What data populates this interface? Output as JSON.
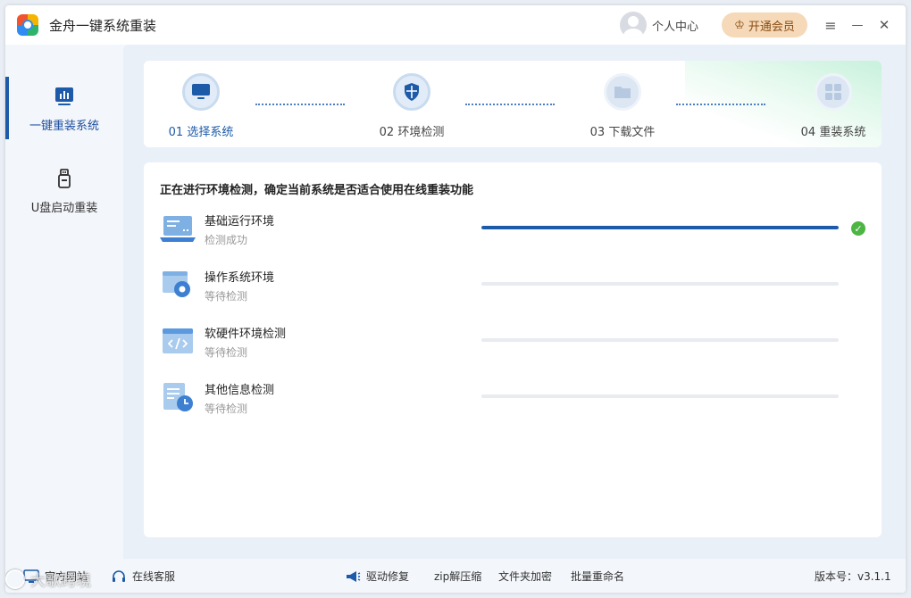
{
  "app": {
    "title": "金舟一键系统重装"
  },
  "titlebar": {
    "user_center": "个人中心",
    "vip_label": "开通会员",
    "menu_icon": "≡",
    "minimize_icon": "—",
    "close_icon": "✕"
  },
  "sidebar": {
    "items": [
      {
        "label": "一键重装系统",
        "active": true
      },
      {
        "label": "U盘启动重装",
        "active": false
      }
    ]
  },
  "steps": [
    {
      "label": "01 选择系统",
      "active": true
    },
    {
      "label": "02 环境检测",
      "active": false
    },
    {
      "label": "03 下载文件",
      "active": false
    },
    {
      "label": "04 重装系统",
      "active": false
    }
  ],
  "check": {
    "title": "正在进行环境检测，确定当前系统是否适合使用在线重装功能",
    "items": [
      {
        "name": "基础运行环境",
        "status": "检测成功",
        "progress": 1.0,
        "done": true
      },
      {
        "name": "操作系统环境",
        "status": "等待检测",
        "progress": 0,
        "done": false
      },
      {
        "name": "软硬件环境检测",
        "status": "等待检测",
        "progress": 0,
        "done": false
      },
      {
        "name": "其他信息检测",
        "status": "等待检测",
        "progress": 0,
        "done": false
      }
    ]
  },
  "footer": {
    "website": "官方网站",
    "support": "在线客服",
    "driver_repair": "驱动修复",
    "zip": "zip解压缩",
    "folder_encrypt": "文件夹加密",
    "batch_rename": "批量重命名",
    "version": "版本号：v3.1.1"
  },
  "watermark": "大歌跨境",
  "colors": {
    "accent": "#1d5aa8",
    "success": "#4cb544",
    "vip_bg": "#f5d9b8"
  }
}
